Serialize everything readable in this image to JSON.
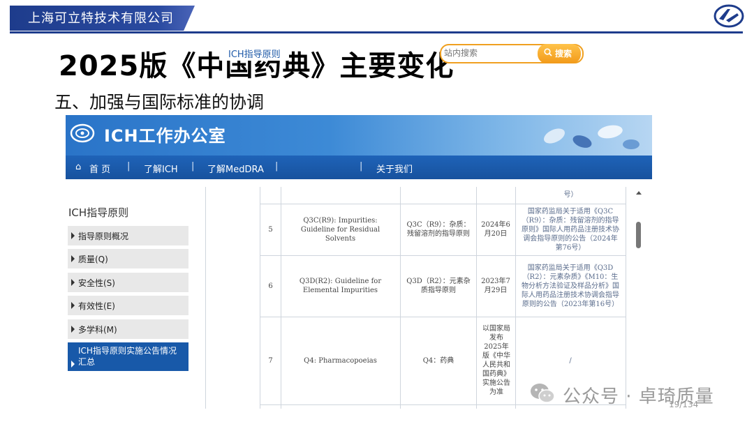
{
  "slide": {
    "company": "上海可立特技术有限公司",
    "title": "2025版《中国药典》主要变化",
    "subtitle": "五、加强与国际标准的协调",
    "page_number": "19/134"
  },
  "site": {
    "title": "ICH工作办公室",
    "nav": [
      "首 页",
      "了解ICH",
      "了解MedDRA",
      "ICH指导原则",
      "关于我们"
    ],
    "nav_active": "ICH指导原则",
    "search_placeholder": "站内搜索",
    "search_button": "搜索"
  },
  "sidebar": {
    "heading": "ICH指导原则",
    "items": [
      "指导原则概况",
      "质量(Q)",
      "安全性(S)",
      "有效性(E)",
      "多学科(M)",
      "ICH指导原则实施公告情况汇总"
    ],
    "active_item": "ICH指导原则实施公告情况汇总"
  },
  "table": {
    "partial_top": "号）",
    "rows": [
      {
        "no": "5",
        "english": "Q3C(R9): Impurities: Guideline for Residual Solvents",
        "chinese": "Q3C（R9）：杂质：残留溶剂的指导原则",
        "date": "2024年6月20日",
        "announcement": "国家药监局关于适用《Q3C（R9）：杂质：残留溶剂的指导原则》国际人用药品注册技术协调会指导原则的公告（2024年第76号）"
      },
      {
        "no": "6",
        "english": "Q3D(R2): Guideline for Elemental Impurities",
        "chinese": "Q3D（R2）：元素杂质指导原则",
        "date": "2023年7月29日",
        "announcement": "国家药监局关于适用《Q3D（R2）：元素杂质》《M10：生物分析方法验证及样品分析》国际人用药品注册技术协调会指导原则的公告（2023年第16号）"
      },
      {
        "no": "7",
        "english": "Q4: Pharmacopoeias",
        "chinese": "Q4：药典",
        "date": "以国家局发布2025年版《中华人民共和国药典》实施公告为准",
        "announcement": "/"
      }
    ]
  },
  "watermark": "公众号 · 卓琦质量"
}
